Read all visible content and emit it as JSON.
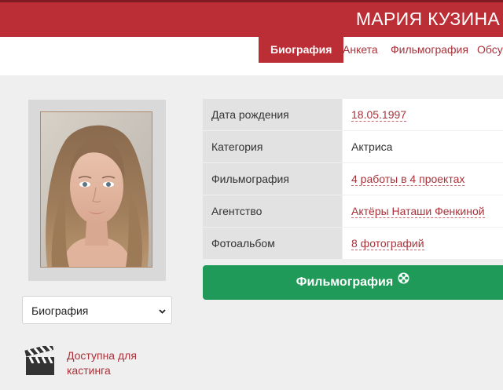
{
  "header": {
    "name": "МАРИЯ КУЗИНА"
  },
  "tabs": [
    {
      "label": "Биография",
      "active": true
    },
    {
      "label": "Анкета",
      "active": false
    },
    {
      "label": "Фильмография",
      "active": false
    },
    {
      "label": "Обсуж",
      "active": false
    }
  ],
  "sidebar": {
    "select_value": "Биография",
    "casting_label": "Доступна для кастинга"
  },
  "info": [
    {
      "label": "Дата рождения",
      "value": "18.05.1997",
      "link": true
    },
    {
      "label": "Категория",
      "value": "Актриса",
      "link": false
    },
    {
      "label": "Фильмография",
      "value": "4 работы в 4 проектах",
      "link": true
    },
    {
      "label": "Агентство",
      "value": "Актёры Наташи Фенкиной",
      "link": true
    },
    {
      "label": "Фотоальбом",
      "value": "8 фотографий",
      "link": true
    }
  ],
  "button": {
    "label": "Фильмография"
  },
  "colors": {
    "brand": "#bb2e35",
    "link": "#a8323a",
    "button": "#1f9a58"
  }
}
